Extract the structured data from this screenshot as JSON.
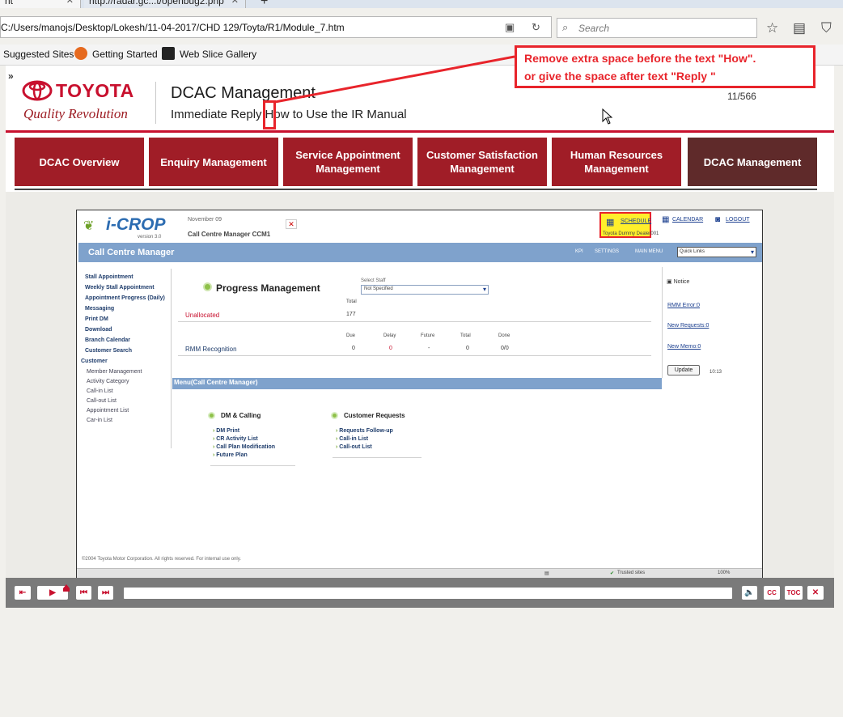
{
  "browser": {
    "tabs": [
      {
        "label": "nt",
        "close": "✕"
      },
      {
        "label": "http://radar.gc...t/openbug2.php",
        "close": "✕"
      }
    ],
    "new_tab": "+",
    "url": "C:/Users/manojs/Desktop/Lokesh/11-04-2017/CHD 129/Toyta/R1/Module_7.htm",
    "search_placeholder": "Search",
    "bookmarks": [
      "Suggested Sites",
      "Getting Started",
      "Web Slice Gallery"
    ]
  },
  "header": {
    "expand": "»",
    "brand": "TOYOTA",
    "brand_tagline": "Quality Revolution",
    "module_title": "DCAC Management",
    "crumb_a": "Immediate Reply",
    "crumb_b": "How to Use the IR Manual",
    "counter": "11/566"
  },
  "nav": [
    "DCAC Overview",
    "Enquiry Management",
    "Service Appointment Management",
    "Customer Satisfaction Management",
    "Human Resources Management",
    "DCAC Management"
  ],
  "screenshot": {
    "logo": "i-CROP",
    "version": "version 3.0",
    "date": "November 09",
    "user": "Call Centre Manager CCM1",
    "top_links": [
      "SCHEDULE",
      "CALENDAR",
      "LOGOUT"
    ],
    "dealer": "Toyota Dummy Dealer001",
    "bar_title": "Call Centre Manager",
    "bar_links": [
      "KPI",
      "SETTINGS",
      "MAIN MENU"
    ],
    "quick_links": "Quick Links",
    "side": {
      "items": [
        "Stall Appointment",
        "Weekly Stall Appointment",
        "Appointment Progress (Daily)",
        "Messaging",
        "Print DM",
        "Download",
        "Branch Calendar",
        "Customer Search"
      ],
      "section": "Customer",
      "sub": [
        "Member Management",
        "Activity Category",
        "Call-in List",
        "Call-out List",
        "Appointment List",
        "Car-in List"
      ]
    },
    "progress_title": "Progress Management",
    "select_staff_label": "Select Staff",
    "select_staff_value": "Not Specified",
    "total_label": "Total",
    "unallocated": "Unallocated",
    "unallocated_total": "177",
    "col_heads": [
      "Due",
      "Delay",
      "Future",
      "Total",
      "Done"
    ],
    "rmm": "RMM Recognition",
    "rmm_vals": [
      "0",
      "0",
      "-",
      "0",
      "0/0"
    ],
    "notice": "Notice",
    "notice_links": [
      "RMM Error:0",
      "New Requests:0",
      "New Memo:0"
    ],
    "update": "Update",
    "time": "10:13",
    "menu_bar": "Menu(Call Centre Manager)",
    "group1": {
      "title": "DM & Calling",
      "links": [
        "DM Print",
        "CR Activity List",
        "Call Plan Modification",
        "Future Plan"
      ]
    },
    "group2": {
      "title": "Customer Requests",
      "links": [
        "Requests Follow-up",
        "Call-in List",
        "Call-out List"
      ]
    },
    "copyright": "©2004 Toyota Motor Corporation. All rights reserved. For internal use only.",
    "status_trusted": "Trusted sites",
    "status_zoom": "100%"
  },
  "player": {
    "cc": "CC",
    "toc": "TOC",
    "close": "✕",
    "progress": 0.1
  },
  "annotation": {
    "line1": "Remove extra space before the text \"How\".",
    "line2": "or give the space after text \"Reply \""
  }
}
